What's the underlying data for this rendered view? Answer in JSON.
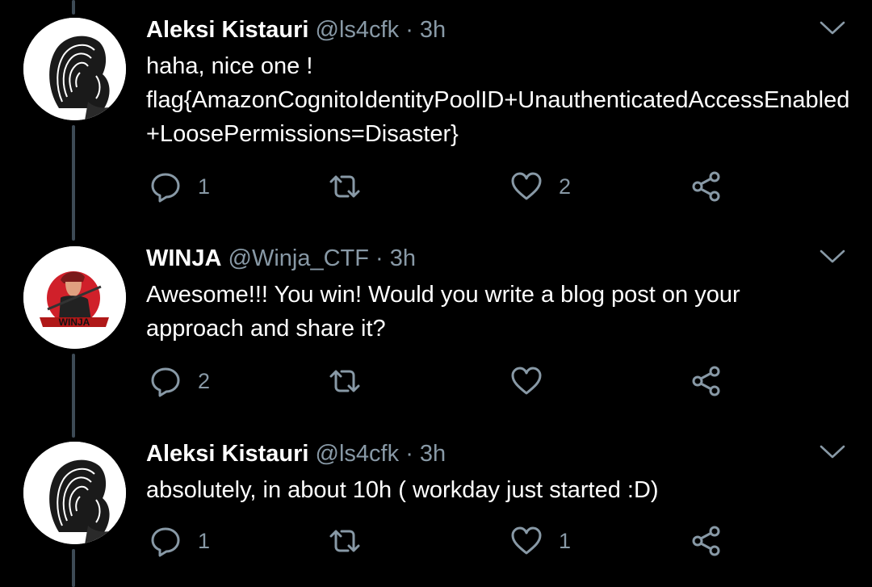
{
  "colors": {
    "background": "#000000",
    "text_primary": "#ffffff",
    "text_secondary": "#8899a6",
    "thread_line": "#3d4a55"
  },
  "tweets": [
    {
      "name": "Aleksi Kistauri",
      "handle": "@ls4cfk",
      "separator": "·",
      "time": "3h",
      "text_line1": "haha, nice one !",
      "text_line2": "flag{AmazonCognitoIdentityPoolID+UnauthenticatedAccessEnabled+LoosePermissions=Disaster}",
      "avatar": "sketch-face-avatar",
      "reply_count": "1",
      "retweet_count": "",
      "like_count": "2"
    },
    {
      "name": "WINJA",
      "handle": "@Winja_CTF",
      "separator": "·",
      "time": "3h",
      "text_line1": "Awesome!!! You win! Would you write a blog post on your approach and share it?",
      "text_line2": "",
      "avatar": "winja-logo-avatar",
      "reply_count": "2",
      "retweet_count": "",
      "like_count": ""
    },
    {
      "name": "Aleksi Kistauri",
      "handle": "@ls4cfk",
      "separator": "·",
      "time": "3h",
      "text_line1": "absolutely, in about 10h ( workday just started :D)",
      "text_line2": "",
      "avatar": "sketch-face-avatar",
      "reply_count": "1",
      "retweet_count": "",
      "like_count": "1"
    }
  ],
  "icons": {
    "reply": "reply-icon",
    "retweet": "retweet-icon",
    "like": "heart-icon",
    "share": "share-icon",
    "menu": "chevron-down-icon"
  }
}
